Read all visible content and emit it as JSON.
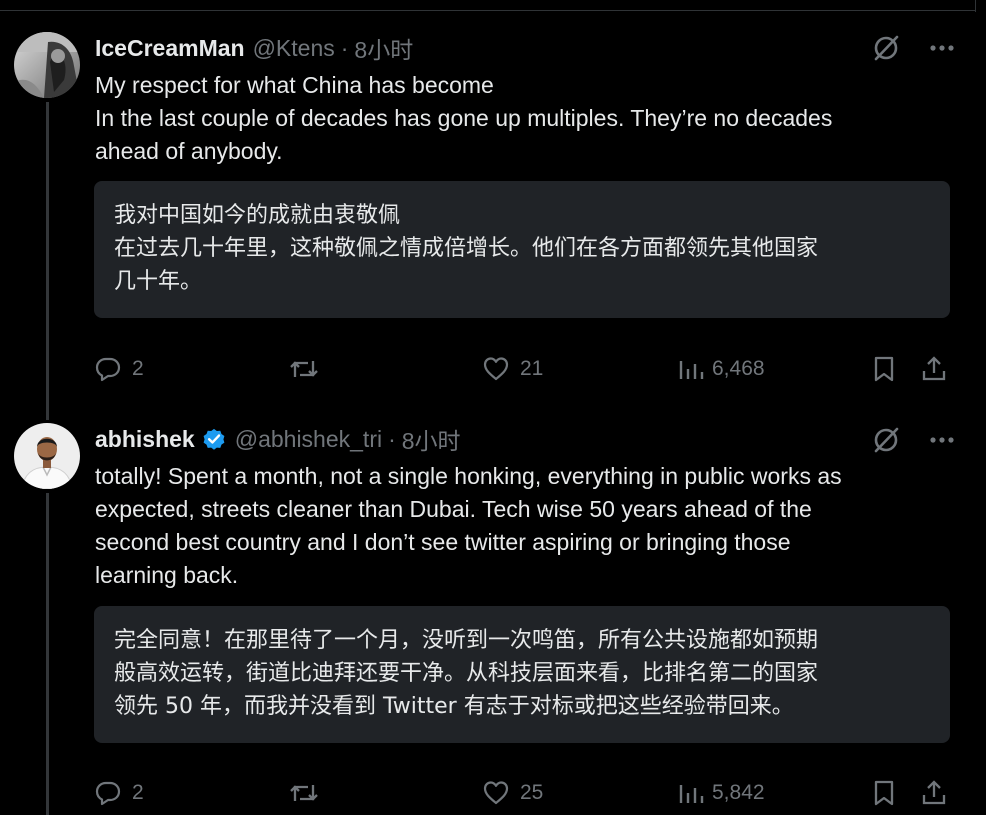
{
  "tweets": [
    {
      "author": {
        "name": "IceCreamMan",
        "handle": "@Ktens",
        "verified": false,
        "avatar_icon": "avatar-photo"
      },
      "separator": "·",
      "time": "8小时",
      "text_lines": [
        "My respect for what China has become",
        "In the last couple of decades has gone up multiples. They’re no decades",
        "ahead of anybody."
      ],
      "translation_lines": [
        "我对中国如今的成就由衷敬佩",
        "在过去几十年里，这种敬佩之情成倍增长。他们在各方面都领先其他国家",
        "几十年。"
      ],
      "stats": {
        "replies": "2",
        "reposts": "",
        "likes": "21",
        "views": "6,468"
      }
    },
    {
      "author": {
        "name": "abhishek",
        "handle": "@abhishek_tri",
        "verified": true,
        "avatar_icon": "avatar-photo"
      },
      "separator": "·",
      "time": "8小时",
      "text_lines": [
        "totally! Spent a month, not a single honking, everything in public works as",
        "expected, streets cleaner than Dubai. Tech wise 50 years ahead of the",
        "second best country and I don’t see twitter aspiring or bringing those",
        "learning back."
      ],
      "translation_lines": [
        "完全同意！在那里待了一个月，没听到一次鸣笛，所有公共设施都如预期",
        "般高效运转，街道比迪拜还要干净。从科技层面来看，比排名第二的国家",
        "领先 50 年，而我并没看到 Twitter 有志于对标或把这些经验带回来。"
      ],
      "stats": {
        "replies": "2",
        "reposts": "",
        "likes": "25",
        "views": "5,842"
      }
    }
  ],
  "icons": {
    "grok": "grok-slash-circle-icon",
    "more": "more-dots-icon",
    "reply": "reply-bubble-icon",
    "repost": "repost-arrows-icon",
    "like": "heart-icon",
    "views": "views-bars-icon",
    "bookmark": "bookmark-icon",
    "share": "share-upload-icon",
    "verified": "verified-badge-icon"
  },
  "colors": {
    "background": "#000000",
    "text_primary": "#e7e9ea",
    "text_secondary": "#71767b",
    "translation_bg": "#202327",
    "verified_blue": "#1d9bf0",
    "thread_line": "#333639"
  }
}
